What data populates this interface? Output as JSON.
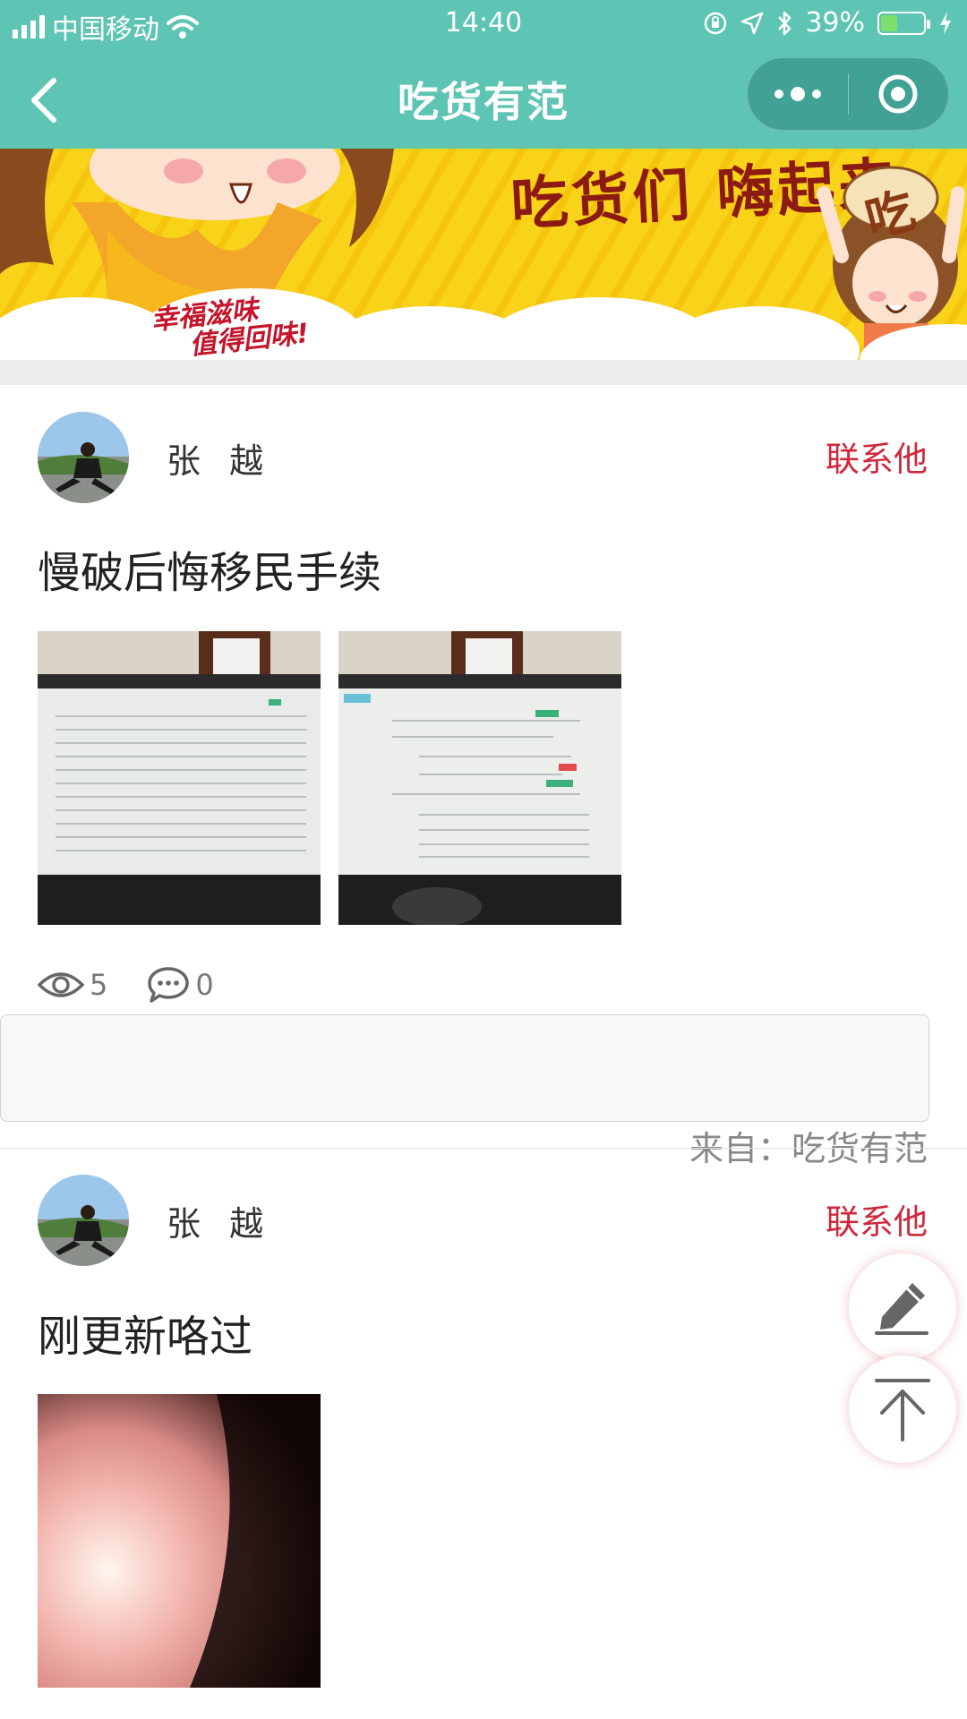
{
  "status_bar": {
    "carrier": "中国移动",
    "time": "14:40",
    "battery_percent": "39%",
    "battery_level": 0.39
  },
  "nav": {
    "title": "吃货有范",
    "more_icon": "more-dots-icon",
    "close_icon": "target-circle-icon",
    "back_icon": "chevron-left-icon"
  },
  "banner": {
    "headline": "吃货们 嗨起来",
    "tagline_line1": "幸福滋味",
    "tagline_line2": "值得回味!",
    "sticker_text": "吃"
  },
  "posts": [
    {
      "author": "张 越",
      "contact_label": "联系他",
      "text": "慢破后悔移民手续",
      "views": "5",
      "comments": "0",
      "source_label": "来自：",
      "source_name": "吃货有范"
    },
    {
      "author": "张 越",
      "contact_label": "联系他",
      "text": "刚更新咯过"
    }
  ],
  "fab": {
    "edit_icon": "pencil-icon",
    "top_icon": "arrow-up-to-top-icon"
  },
  "colors": {
    "header": "#5ec4b4",
    "contact": "#d0283c",
    "banner_yellow": "#f9d21a"
  }
}
